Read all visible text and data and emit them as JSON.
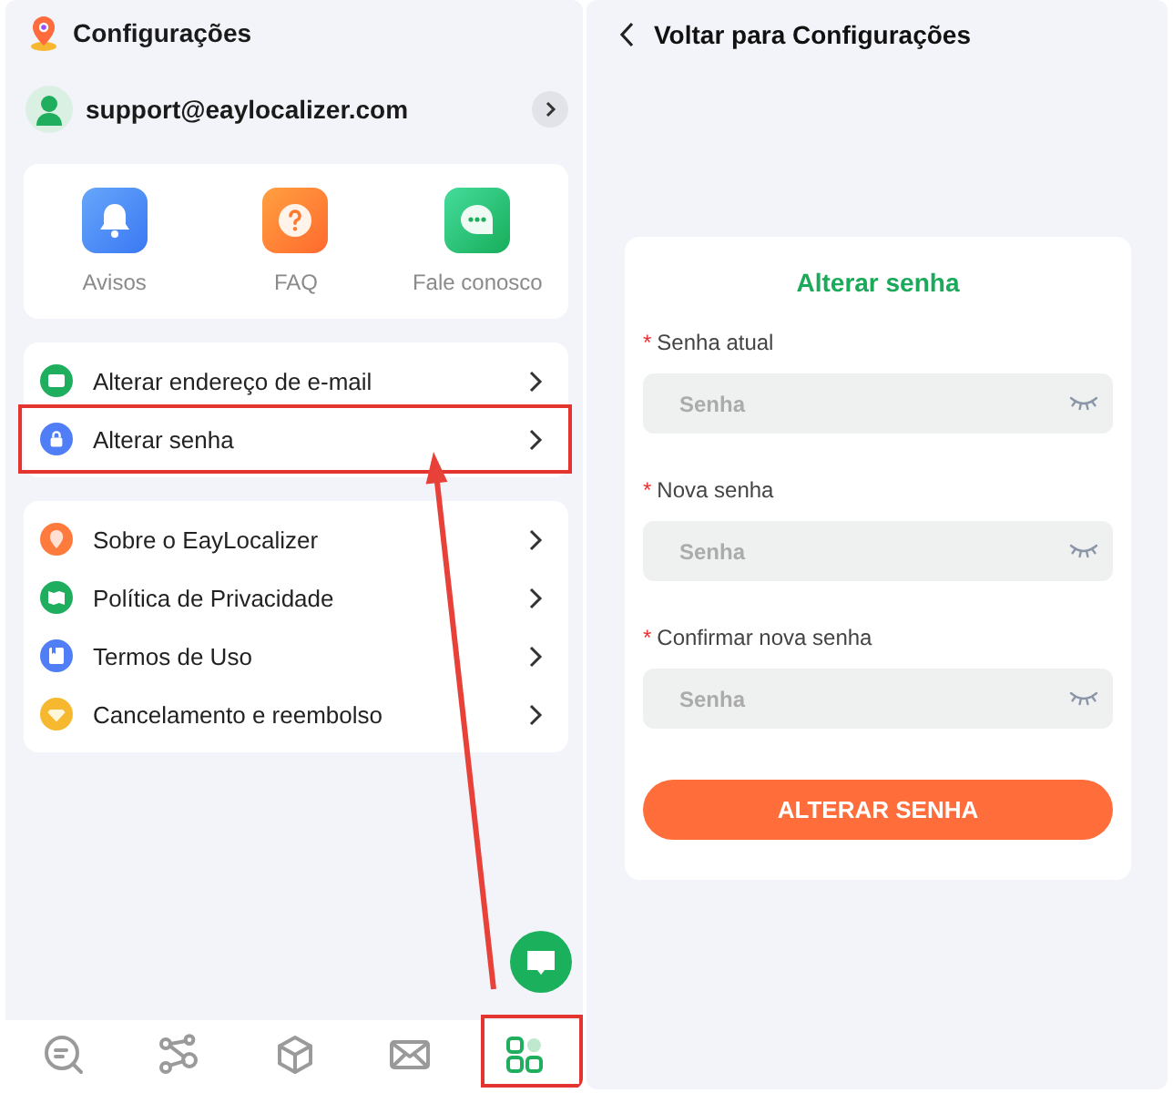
{
  "settings": {
    "title": "Configurações",
    "account": {
      "email": "support@eaylocalizer.com"
    },
    "quick_actions": [
      {
        "label": "Avisos"
      },
      {
        "label": "FAQ"
      },
      {
        "label": "Fale conosco"
      }
    ],
    "menu_groups": [
      {
        "items": [
          {
            "label": "Alterar endereço de e-mail",
            "color": "#1fae5e",
            "highlighted": false
          },
          {
            "label": "Alterar senha",
            "color": "#4f7ef7",
            "highlighted": true
          }
        ]
      },
      {
        "items": [
          {
            "label": "Sobre o EayLocalizer",
            "color": "#ff7a3d",
            "highlighted": false
          },
          {
            "label": "Política de Privacidade",
            "color": "#1fae5e",
            "highlighted": false
          },
          {
            "label": "Termos de Uso",
            "color": "#4f7ef7",
            "highlighted": false
          },
          {
            "label": "Cancelamento e reembolso",
            "color": "#f5b82e",
            "highlighted": false
          }
        ]
      }
    ],
    "bottom_nav": [
      {
        "selected": false,
        "highlighted": false
      },
      {
        "selected": false,
        "highlighted": false
      },
      {
        "selected": false,
        "highlighted": false
      },
      {
        "selected": false,
        "highlighted": false
      },
      {
        "selected": true,
        "highlighted": true
      }
    ]
  },
  "change_password": {
    "back_label": "Voltar para Configurações",
    "form": {
      "title": "Alterar senha",
      "fields": [
        {
          "label": "Senha atual",
          "required_mark": "*",
          "placeholder": "Senha",
          "visible": false
        },
        {
          "label": "Nova senha",
          "required_mark": "*",
          "placeholder": "Senha",
          "visible": false
        },
        {
          "label": "Confirmar nova senha",
          "required_mark": "*",
          "placeholder": "Senha",
          "visible": false
        }
      ],
      "submit": "ALTERAR SENHA"
    }
  }
}
